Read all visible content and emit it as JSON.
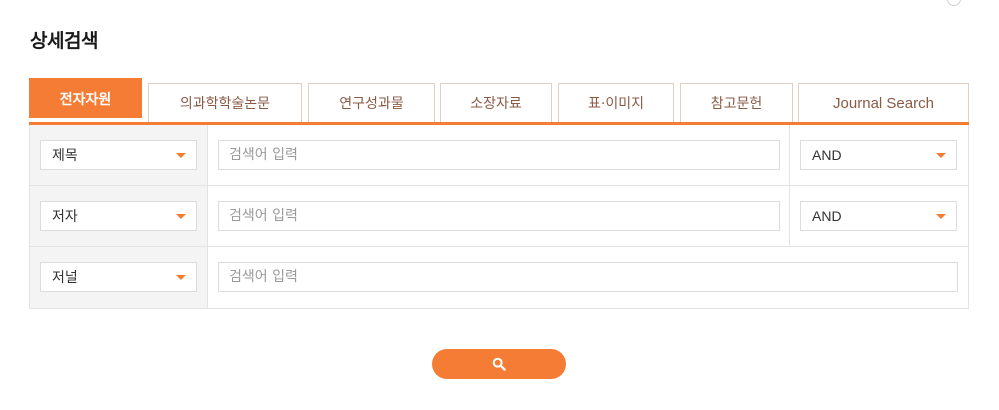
{
  "page": {
    "title": "상세검색"
  },
  "tabs": [
    {
      "label": "전자자원",
      "active": true
    },
    {
      "label": "의과학학술논문",
      "active": false
    },
    {
      "label": "연구성과물",
      "active": false
    },
    {
      "label": "소장자료",
      "active": false
    },
    {
      "label": "표·이미지",
      "active": false
    },
    {
      "label": "참고문헌",
      "active": false
    },
    {
      "label": "Journal Search",
      "active": false
    }
  ],
  "rows": [
    {
      "field": "제목",
      "placeholder": "검색어 입력",
      "operator": "AND"
    },
    {
      "field": "저자",
      "placeholder": "검색어 입력",
      "operator": "AND"
    },
    {
      "field": "저널",
      "placeholder": "검색어 입력"
    }
  ],
  "search_button": {
    "icon": "search-icon"
  },
  "colors": {
    "accent": "#f57c35",
    "tab_text": "#8a5a45",
    "border": "#e3e3e3"
  }
}
